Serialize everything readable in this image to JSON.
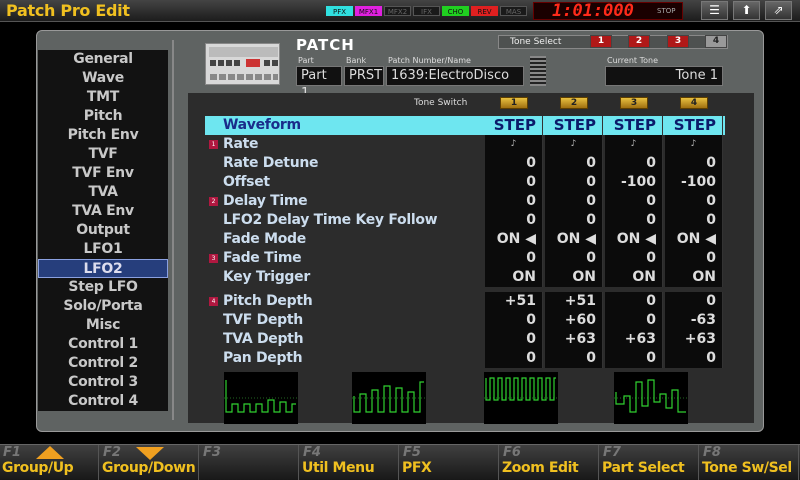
{
  "title_bar": {
    "title": "Patch Pro Edit",
    "fx_indicators": [
      "PFX",
      "MFX1",
      "MFX2",
      "IFX",
      "CHO",
      "REV",
      "MAS"
    ],
    "fx_colors": [
      "#30e0e0",
      "#e020e0",
      "#555555",
      "#555555",
      "#20d020",
      "#e02020",
      "#555555"
    ],
    "clock": "1:01:000",
    "clock_state": "STOP",
    "icons": [
      "list-icon",
      "up-icon",
      "export-icon"
    ]
  },
  "sidebar": {
    "items": [
      "General",
      "Wave",
      "TMT",
      "Pitch",
      "Pitch Env",
      "TVF",
      "TVF Env",
      "TVA",
      "TVA Env",
      "Output",
      "LFO1",
      "LFO2",
      "Step LFO",
      "Solo/Porta",
      "Misc",
      "Control 1",
      "Control 2",
      "Control 3",
      "Control 4"
    ],
    "selected": "LFO2"
  },
  "patch": {
    "title": "PATCH",
    "part_label": "Part",
    "part_value": "Part 1",
    "bank_label": "Bank",
    "bank_value": "PRST",
    "number_label": "Patch Number/Name",
    "number_value": "1639:ElectroDisco",
    "current_tone_label": "Current Tone",
    "current_tone_value": "Tone 1"
  },
  "tone_select": {
    "label": "Tone Select",
    "tones": [
      "1",
      "2",
      "3",
      "4"
    ]
  },
  "tone_switch": {
    "label": "Tone Switch",
    "tones": [
      "1",
      "2",
      "3",
      "4"
    ]
  },
  "table": {
    "rows": [
      {
        "name": "Waveform",
        "header": true,
        "values": [
          "STEP",
          "STEP",
          "STEP",
          "STEP"
        ]
      },
      {
        "name": "Rate",
        "badge": "1",
        "values": [
          "♪",
          "♪",
          "♪",
          "♪"
        ],
        "tiny": true
      },
      {
        "name": "Rate Detune",
        "values": [
          "0",
          "0",
          "0",
          "0"
        ]
      },
      {
        "name": "Offset",
        "values": [
          "0",
          "0",
          "-100",
          "-100"
        ]
      },
      {
        "name": "Delay Time",
        "badge": "2",
        "values": [
          "0",
          "0",
          "0",
          "0"
        ]
      },
      {
        "name": "LFO2 Delay Time Key Follow",
        "values": [
          "0",
          "0",
          "0",
          "0"
        ]
      },
      {
        "name": "Fade Mode",
        "values": [
          "ON ◀",
          "ON ◀",
          "ON ◀",
          "ON ◀"
        ]
      },
      {
        "name": "Fade Time",
        "badge": "3",
        "values": [
          "0",
          "0",
          "0",
          "0"
        ]
      },
      {
        "name": "Key Trigger",
        "values": [
          "ON",
          "ON",
          "ON",
          "ON"
        ]
      },
      {
        "name": "Pitch Depth",
        "badge": "4",
        "values": [
          "+51",
          "+51",
          "0",
          "0"
        ]
      },
      {
        "name": "TVF Depth",
        "values": [
          "0",
          "+60",
          "0",
          "-63"
        ]
      },
      {
        "name": "TVA Depth",
        "values": [
          "0",
          "+63",
          "+63",
          "+63"
        ]
      },
      {
        "name": "Pan Depth",
        "values": [
          "0",
          "0",
          "0",
          "0"
        ]
      }
    ]
  },
  "function_keys": [
    {
      "key": "F1",
      "label": "Group/Up",
      "arrow": "up"
    },
    {
      "key": "F2",
      "label": "Group/Down",
      "arrow": "down"
    },
    {
      "key": "F3",
      "label": ""
    },
    {
      "key": "F4",
      "label": "Util Menu"
    },
    {
      "key": "F5",
      "label": "PFX"
    },
    {
      "key": "F6",
      "label": "Zoom Edit"
    },
    {
      "key": "F7",
      "label": "Part Select"
    },
    {
      "key": "F8",
      "label": "Tone Sw/Sel"
    }
  ]
}
